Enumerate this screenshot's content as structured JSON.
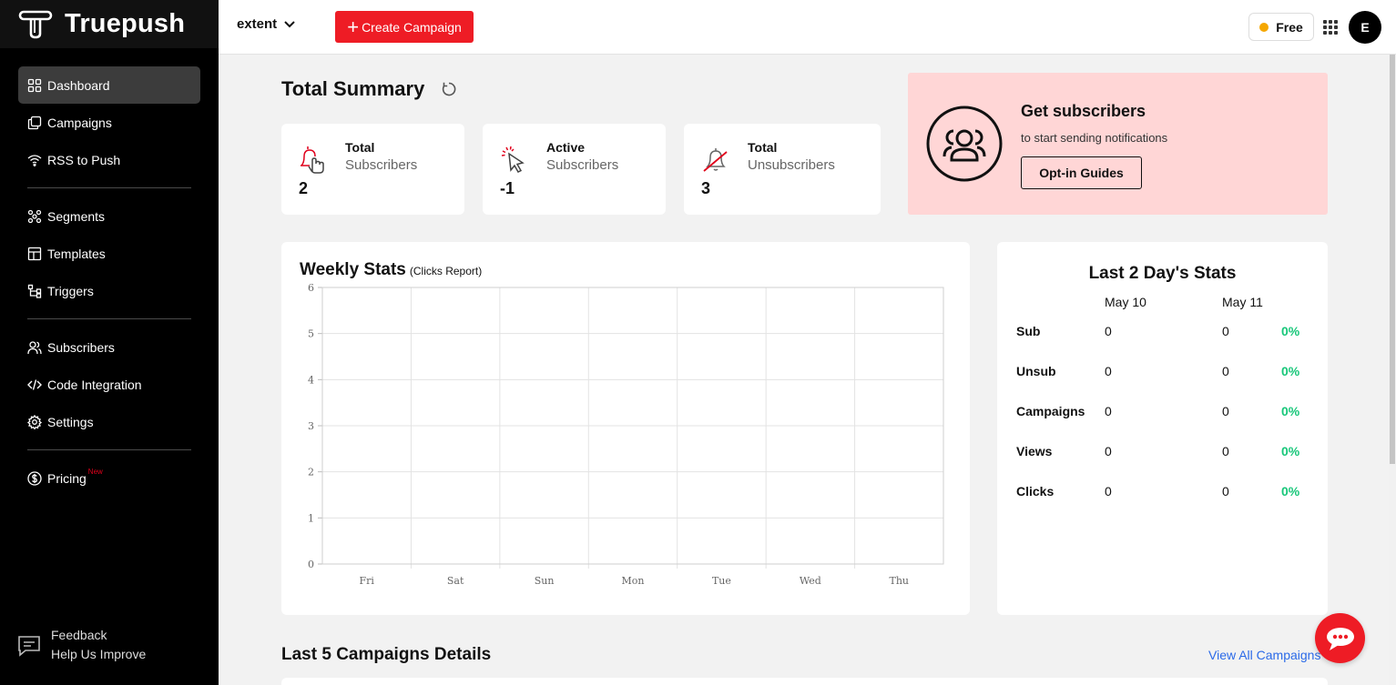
{
  "brand": {
    "name": "Truepush"
  },
  "sidebar": {
    "items": [
      {
        "label": "Dashboard",
        "icon": "grid-icon"
      },
      {
        "label": "Campaigns",
        "icon": "copy-icon"
      },
      {
        "label": "RSS to Push",
        "icon": "wifi-icon"
      },
      {
        "label": "Segments",
        "icon": "segments-icon"
      },
      {
        "label": "Templates",
        "icon": "template-icon"
      },
      {
        "label": "Triggers",
        "icon": "trigger-icon"
      },
      {
        "label": "Subscribers",
        "icon": "users-icon"
      },
      {
        "label": "Code Integration",
        "icon": "code-icon"
      },
      {
        "label": "Settings",
        "icon": "gear-icon"
      },
      {
        "label": "Pricing",
        "icon": "dollar-icon",
        "badge": "New"
      }
    ],
    "feedback": {
      "title": "Feedback",
      "subtitle": "Help Us Improve"
    }
  },
  "topbar": {
    "site": "extent",
    "create_label": "Create Campaign",
    "plan": "Free",
    "avatar": "E"
  },
  "summary": {
    "title": "Total Summary",
    "cards": [
      {
        "l1": "Total",
        "l2": "Subscribers",
        "value": "2"
      },
      {
        "l1": "Active",
        "l2": "Subscribers",
        "value": "-1"
      },
      {
        "l1": "Total",
        "l2": "Unsubscribers",
        "value": "3"
      }
    ]
  },
  "promo": {
    "title": "Get subscribers",
    "subtitle": "to start sending notifications",
    "button": "Opt-in Guides"
  },
  "weekly": {
    "title": "Weekly Stats",
    "subtitle": "(Clicks Report)"
  },
  "chart_data": {
    "type": "line",
    "categories": [
      "Fri",
      "Sat",
      "Sun",
      "Mon",
      "Tue",
      "Wed",
      "Thu"
    ],
    "series": [],
    "ylim": [
      0,
      6
    ],
    "yticks": [
      0,
      1,
      2,
      3,
      4,
      5,
      6
    ],
    "grid": true
  },
  "last2": {
    "title": "Last 2 Day's Stats",
    "col1": "May 10",
    "col2": "May 11",
    "rows": [
      {
        "label": "Sub",
        "a": "0",
        "b": "0",
        "p": "0%"
      },
      {
        "label": "Unsub",
        "a": "0",
        "b": "0",
        "p": "0%"
      },
      {
        "label": "Campaigns",
        "a": "0",
        "b": "0",
        "p": "0%"
      },
      {
        "label": "Views",
        "a": "0",
        "b": "0",
        "p": "0%"
      },
      {
        "label": "Clicks",
        "a": "0",
        "b": "0",
        "p": "0%"
      }
    ]
  },
  "campaigns": {
    "title": "Last 5 Campaigns Details",
    "view_all": "View All Campaigns"
  },
  "colors": {
    "accent": "#ee1c25",
    "promo_bg": "#ffd6d6",
    "positive": "#18c77a",
    "link": "#2b6ae8"
  }
}
